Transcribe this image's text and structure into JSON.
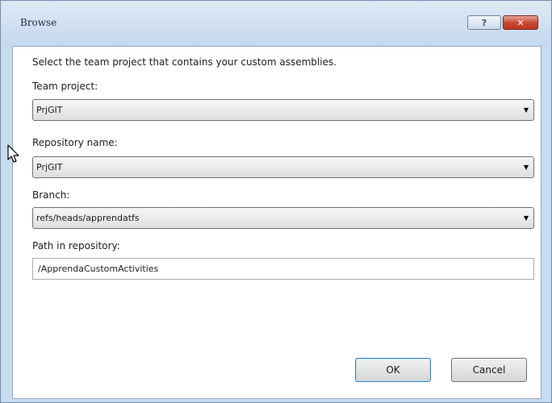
{
  "window": {
    "title": "Browse",
    "help_glyph": "?",
    "close_glyph": "✕"
  },
  "dialog": {
    "instruction": "Select the team project that contains your custom assemblies.",
    "team_project": {
      "label": "Team project:",
      "value": "PrjGIT"
    },
    "repository_name": {
      "label": "Repository name:",
      "value": "PrjGIT"
    },
    "branch": {
      "label": "Branch:",
      "value": "refs/heads/apprendatfs"
    },
    "path": {
      "label": "Path in repository:",
      "value": "/ApprendaCustomActivities"
    },
    "ok_label": "OK",
    "cancel_label": "Cancel",
    "dropdown_glyph": "▼"
  }
}
